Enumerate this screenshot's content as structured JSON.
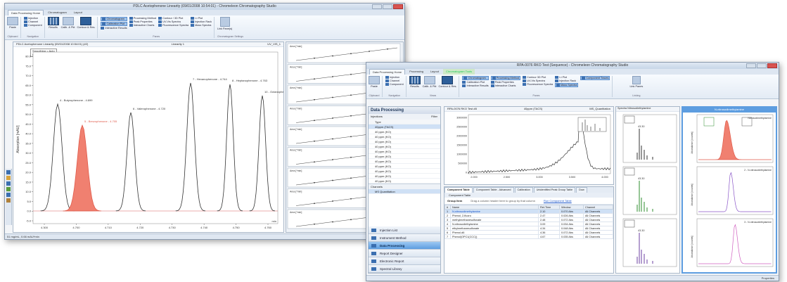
{
  "window1": {
    "title": "PDLC Acetophenone Linearity (09/01/2008 10:54:01) - Chromeleon Chromatography Studio",
    "tabs": [
      "Data Processing Home",
      "Chromatogram",
      "Layout"
    ],
    "ribbon": {
      "paste": "Paste",
      "clipboard_group": "Clipboard",
      "nav_items": [
        "Injection",
        "Channel",
        "Component"
      ],
      "nav_group": "Navigation",
      "results": "Results",
      "calib": "Calib. & Pkt",
      "contour": "Contour & Res.",
      "group_panes": "Panes",
      "plot_items_a": [
        "Chromatogram",
        "Calibration Plot",
        "Interactive Results"
      ],
      "plot_items_b": [
        "Processing Method",
        "Peak Properties",
        "Interactive Charts"
      ],
      "plot_items_c": [
        "Contour / 3D Plot",
        "UV-Vis Spectra",
        "Fluorescence Spectra"
      ],
      "plot_items_d": [
        "I-t Plot",
        "Injection Rack",
        "Mass Spectra"
      ],
      "link_panes": "Link Pane(s)",
      "group_chrom": "Chromatogram Settings"
    },
    "chrom": {
      "header_left": "PDLC Acetophenone Linearity (09/01/2008 10:54:01) (#2)",
      "header_mid": "Linearity 1",
      "header_right": "UV_VIS_1",
      "legend": [
        "Smoothing = Auto",
        "OnlyPeak = Off"
      ],
      "ylabel": "Absorption [mAU]",
      "xunit": "min",
      "yticks": [
        "80.0",
        "75.0",
        "70.0",
        "65.0",
        "60.0",
        "55.0",
        "50.0",
        "45.0",
        "40.0",
        "35.0",
        "30.0",
        "25.0",
        "20.0",
        "15.0",
        "10.0",
        "5.0",
        "0.0",
        "-5.0"
      ],
      "xticks": [
        "4.300",
        "4.700",
        "4.710",
        "4.720",
        "4.730",
        "4.740",
        "4.750",
        "4.760"
      ],
      "peaks": [
        {
          "label": "4 - Butyrophenone - 4.699",
          "highlight": false
        },
        {
          "label": "5 - Benzophenone - 4.705",
          "highlight": true
        },
        {
          "label": "6 - Valerophenone - 4.720",
          "highlight": false
        },
        {
          "label": "7 - Hexanophenone - 4.744",
          "highlight": false
        },
        {
          "label": "8 - Heptanophenone - 4.763",
          "highlight": false
        },
        {
          "label": "10 - Octanophenone",
          "highlight": false
        }
      ]
    },
    "cal_panel_label": "Area [*min]",
    "statusbar": "51 mg/mL, 0.66 mAU*min"
  },
  "window2": {
    "title": "RPA-0076 RKO Test (Sequence) - Chromeleon Chromatography Studio",
    "ctx_tab": "Chromatogram Tools",
    "tabs": [
      "Data Processing Home",
      "Processing",
      "Layout"
    ],
    "ribbon": {
      "paste": "Paste",
      "clipboard_group": "Clipboard",
      "nav_items": [
        "Injection",
        "Channel",
        "Component"
      ],
      "nav_group": "Navigation",
      "results": "Results",
      "calib": "Calib. & Pkt",
      "contour": "Contour & Res.",
      "views_group": "Views",
      "plot_items_a": [
        "Chromatogram",
        "Calibration Plot",
        "Interactive Results"
      ],
      "plot_items_b": [
        "Processing Method",
        "Peak Properties",
        "Interactive Charts"
      ],
      "plot_items_c": [
        "Contour 3D Plot",
        "UV-Vis Spectra",
        "Fluorescence Spectra"
      ],
      "plot_items_d": [
        "I-t Plot",
        "Injection Rack",
        "Mass Spectra"
      ],
      "plot_items_e": [
        "Component Traces"
      ],
      "panes_group": "Panes",
      "link_panes": "Link Panes",
      "linking_group": "Linking"
    },
    "data_processing": {
      "title": "Data Processing",
      "injections_label": "Injections",
      "filter_label": "Filter",
      "columns": [
        "Type",
        "Name"
      ],
      "injections": [
        "40ppm (TACS)",
        "40 ppm (KO)",
        "40 ppm (KO)",
        "40 ppm (KO)",
        "40 ppm (KO)",
        "40 ppm (KO)",
        "40 ppm (KO)",
        "40 ppm (KO)",
        "40 ppm (KO)",
        "40 ppm (KO)",
        "40 ppm (KO)",
        "40 ppm (KO)"
      ],
      "channels_label": "Channels",
      "channel_item": "MS Quantitation"
    },
    "nav": [
      "Injection List",
      "Instrument Method",
      "Data Processing",
      "Report Designer",
      "Electronic Report",
      "Spectral Library"
    ],
    "nav_active": "Data Processing",
    "chrom_header": [
      "RPA-0076 RKO Test #8",
      "40ppm (TACS)",
      "MS_Quantitation"
    ],
    "chrom_xticks": [
      "2.000",
      "2.500",
      "3.000",
      "3.500",
      "4.000"
    ],
    "chrom_yticks": [
      "3000000",
      "2500000",
      "2000000",
      "1500000",
      "1000000",
      "500000",
      "0"
    ],
    "table_tabs": [
      "Component Table",
      "Component Table - Advanced",
      "Calibration",
      "Unidentified Peak Group Table",
      "Dow"
    ],
    "group_by_label": "Group Item",
    "drag_hint": "Drag a column header here to group by that column",
    "run_link": "Run Component Table",
    "table_title": "Component Table",
    "table_headers": [
      "#",
      "Name",
      "Ret.Time",
      "Window",
      "Channel"
    ],
    "table_rows": [
      {
        "num": "1",
        "name": "N-nitrosodimethylamine",
        "rt": "2.10",
        "win": "0.070 Abs",
        "ch": "All Channels"
      },
      {
        "num": "2",
        "name": "Phenol, 2-fluoro",
        "rt": "2.47",
        "win": "0.026 Abs",
        "ch": "All Channels"
      },
      {
        "num": "3",
        "name": "methylmethanesulfonate",
        "rt": "2.48",
        "win": "0.072 Abs",
        "ch": "All Channels"
      },
      {
        "num": "4",
        "name": "N-nitrosodiethylamine",
        "rt": "3.09",
        "win": "0.034 Abs",
        "ch": "All Channels"
      },
      {
        "num": "5",
        "name": "ethylmethanesulfonate",
        "rt": "4.34",
        "win": "0.048 Abs",
        "ch": "All Channels"
      },
      {
        "num": "6",
        "name": "Phenol-d6",
        "rt": "4.36",
        "win": "0.072 Abs",
        "ch": "All Channels"
      },
      {
        "num": "7",
        "name": "Phenol(OPC1(CCC))",
        "rt": "4.67",
        "win": "0.035 Abs",
        "ch": "All Channels"
      }
    ],
    "spectra_header": "Spectra Nitrosodiethylamine",
    "spectra_peaks": [
      "43.30",
      "43.30",
      "43.30"
    ],
    "trace_header": "N-nitrosodimethylamine",
    "trace_sublabels": [
      "Nitrosodimethylamine",
      "2 - N-nitrosodiethylamine",
      "3 - N-nitrosodiethylamine"
    ],
    "trace_ylabel": "Abundance [counts]",
    "status_right": "Properties"
  }
}
